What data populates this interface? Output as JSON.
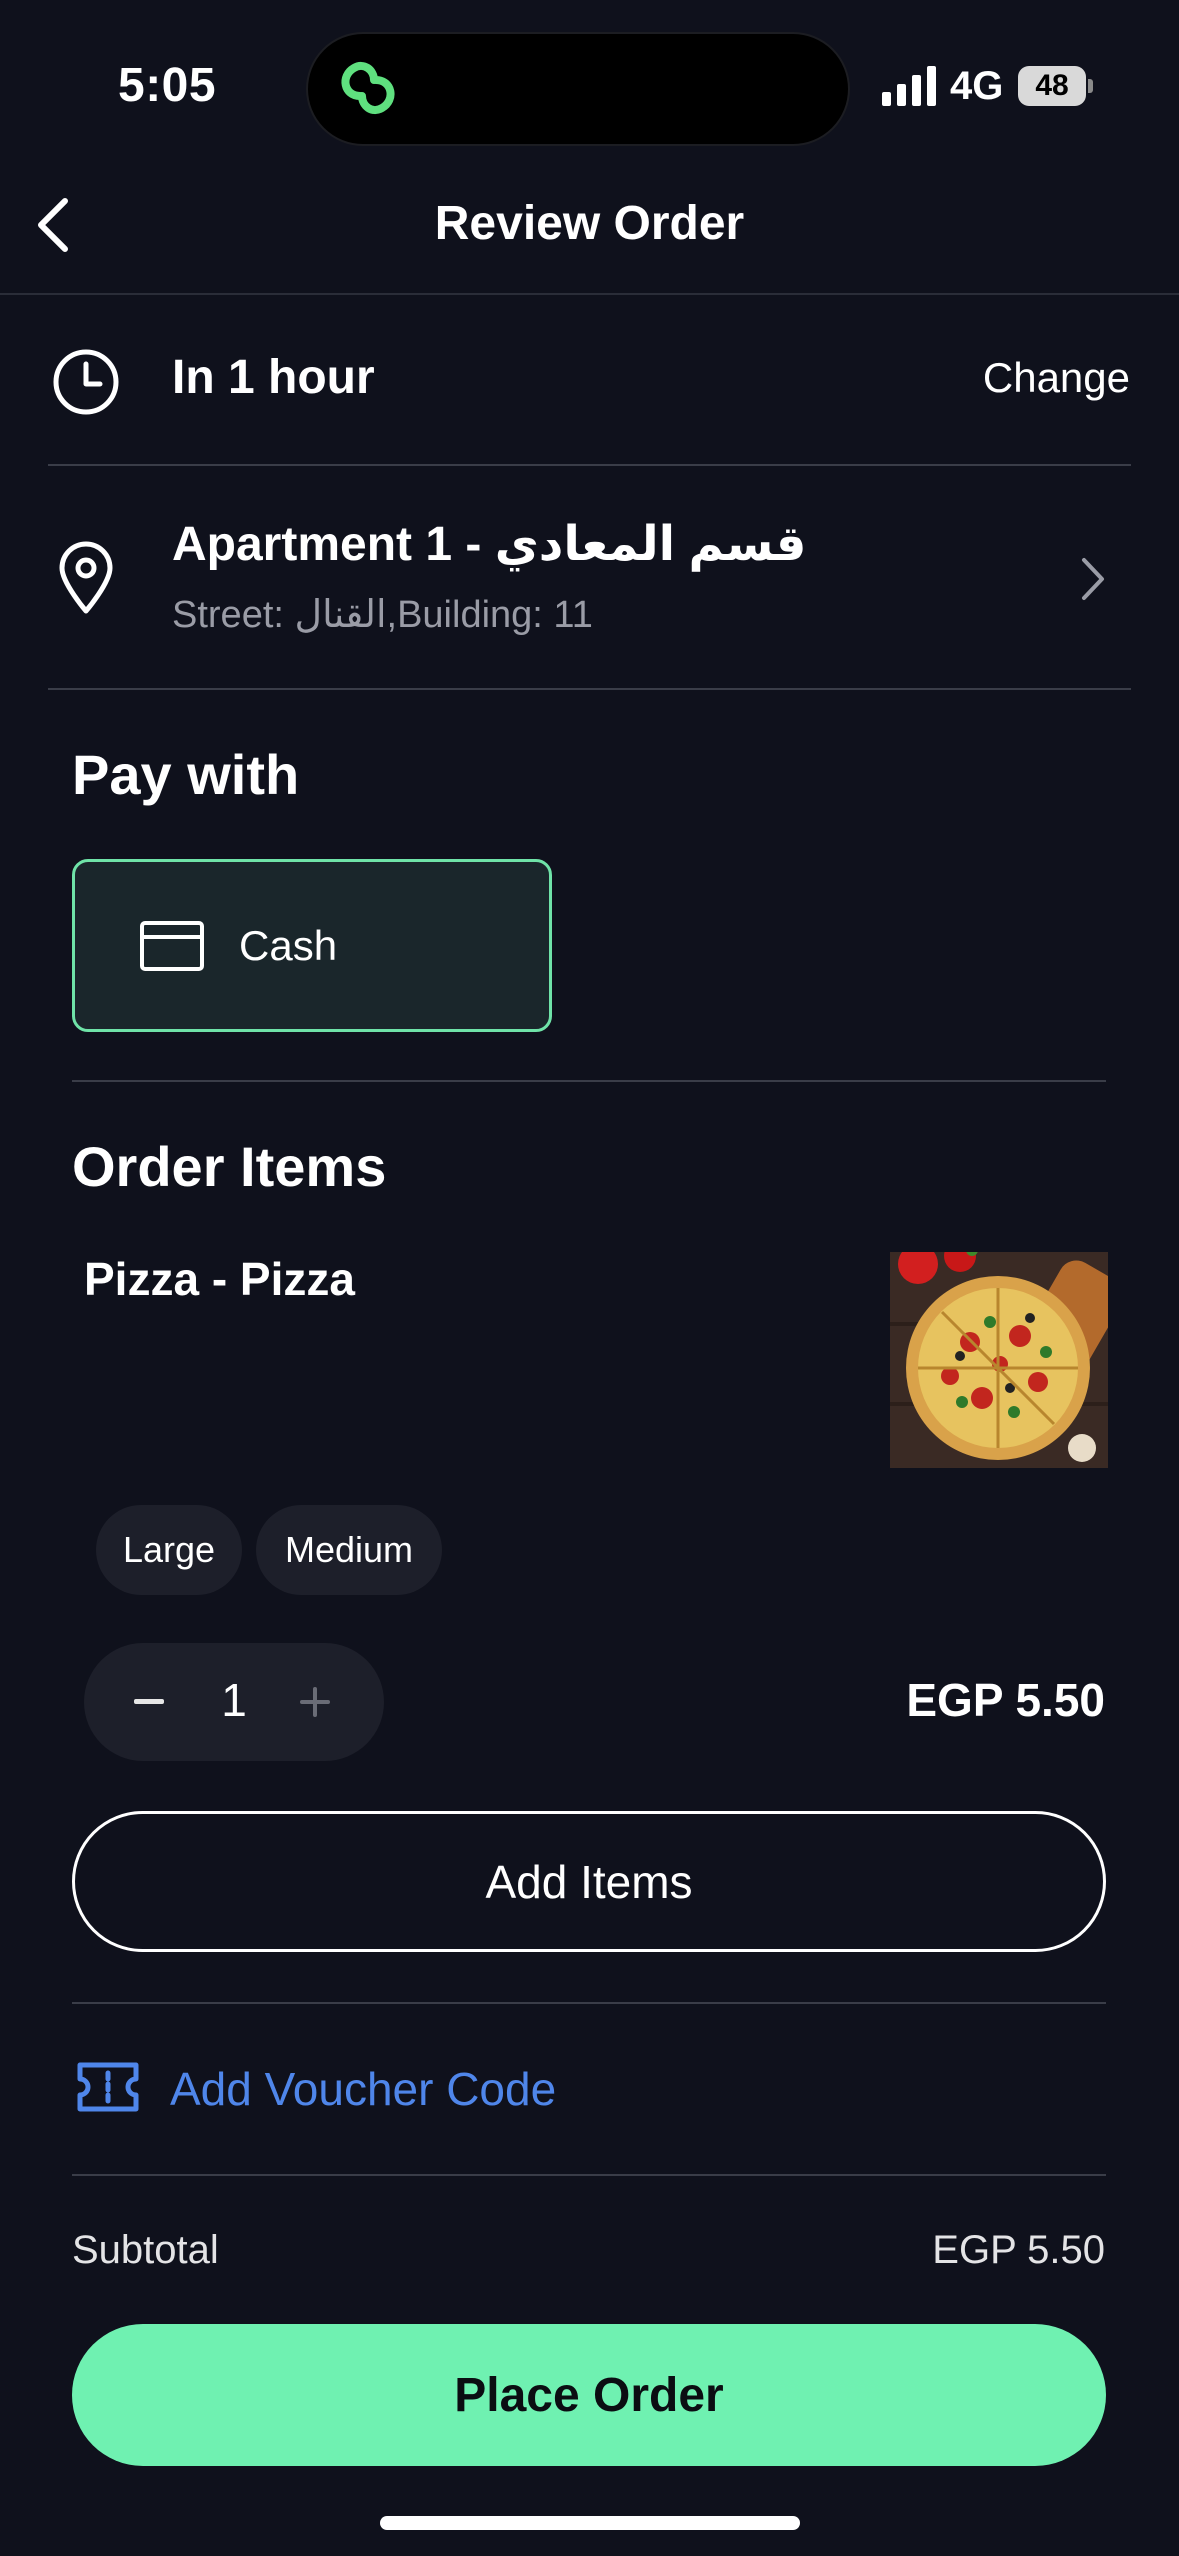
{
  "status_bar": {
    "time": "5:05",
    "network": "4G",
    "battery": "48"
  },
  "header": {
    "title": "Review Order",
    "back_icon": "chevron-left-icon"
  },
  "delivery": {
    "time_label": "In 1 hour",
    "change_label": "Change",
    "icon": "clock-icon"
  },
  "address": {
    "title": "Apartment 1 - قسم المعادي",
    "subtitle": "Street: القنال,Building: 11",
    "icon": "map-pin-icon"
  },
  "payment": {
    "section_title": "Pay with",
    "selected_method": "Cash",
    "icon": "card-icon",
    "accent_color": "#6fe3a8"
  },
  "order_items": {
    "section_title": "Order Items",
    "items": [
      {
        "name": "Pizza - Pizza",
        "options": [
          "Large",
          "Medium"
        ],
        "quantity": "1",
        "price": "EGP 5.50"
      }
    ],
    "add_items_label": "Add Items"
  },
  "voucher": {
    "label": "Add Voucher Code",
    "icon": "ticket-icon",
    "color": "#4f86ea"
  },
  "summary": {
    "subtotal_label": "Subtotal",
    "subtotal_value": "EGP 5.50"
  },
  "cta": {
    "label": "Place Order",
    "color": "#6ff1b1"
  }
}
